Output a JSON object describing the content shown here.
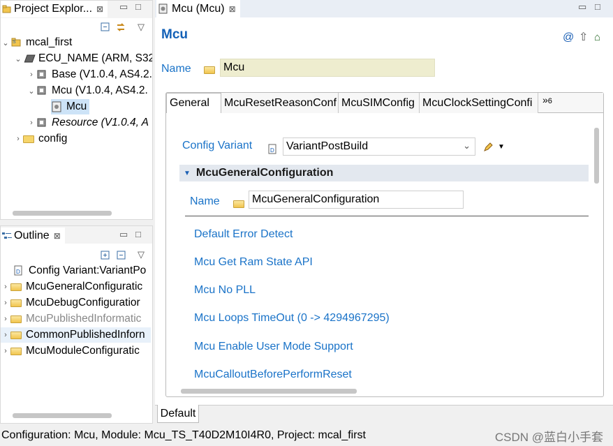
{
  "project_explorer": {
    "tab_label": "Project Explor...",
    "close": "⊠",
    "tree": [
      {
        "label": "mcal_first"
      },
      {
        "label": "ECU_NAME (ARM, S32"
      },
      {
        "label": "Base (V1.0.4, AS4.2."
      },
      {
        "label": "Mcu (V1.0.4, AS4.2."
      },
      {
        "label": "Mcu"
      },
      {
        "label": "Resource (V1.0.4, A"
      },
      {
        "label": "config"
      }
    ]
  },
  "outline": {
    "tab_label": "Outline",
    "close": "⊠",
    "items": [
      {
        "label": "Config Variant:VariantPo"
      },
      {
        "label": "McuGeneralConfiguratic"
      },
      {
        "label": "McuDebugConfiguratior"
      },
      {
        "label": "McuPublishedInformatic"
      },
      {
        "label": "CommonPublishedInforn"
      },
      {
        "label": "McuModuleConfiguratic"
      }
    ]
  },
  "editor": {
    "tab_label": "Mcu (Mcu)",
    "close": "⊠",
    "title": "Mcu",
    "name_label": "Name",
    "name_value": "Mcu",
    "tabs": [
      "General",
      "McuResetReasonConf",
      "McuSIMConfig",
      "McuClockSettingConfi"
    ],
    "more_tabs": "»",
    "more_count": "6",
    "config_variant_label": "Config Variant",
    "config_variant_value": "VariantPostBuild",
    "section_title": "McuGeneralConfiguration",
    "section_name_label": "Name",
    "section_name_value": "McuGeneralConfiguration",
    "params": [
      "Default Error Detect",
      "Mcu Get Ram State API",
      "Mcu No PLL",
      "Mcu Loops TimeOut (0 -> 4294967295)",
      "Mcu Enable User Mode Support",
      "McuCalloutBeforePerformReset"
    ],
    "bottom_tab": "Default"
  },
  "status_bar": {
    "text": "Configuration: Mcu, Module: Mcu_TS_T40D2M10I4R0, Project: mcal_first"
  },
  "watermark": "CSDN @蓝白小手套",
  "colors": {
    "link": "#1a73c8",
    "title": "#1461b7",
    "name_field_bg": "#eeedcf",
    "section_bg": "#e3e8ef"
  }
}
